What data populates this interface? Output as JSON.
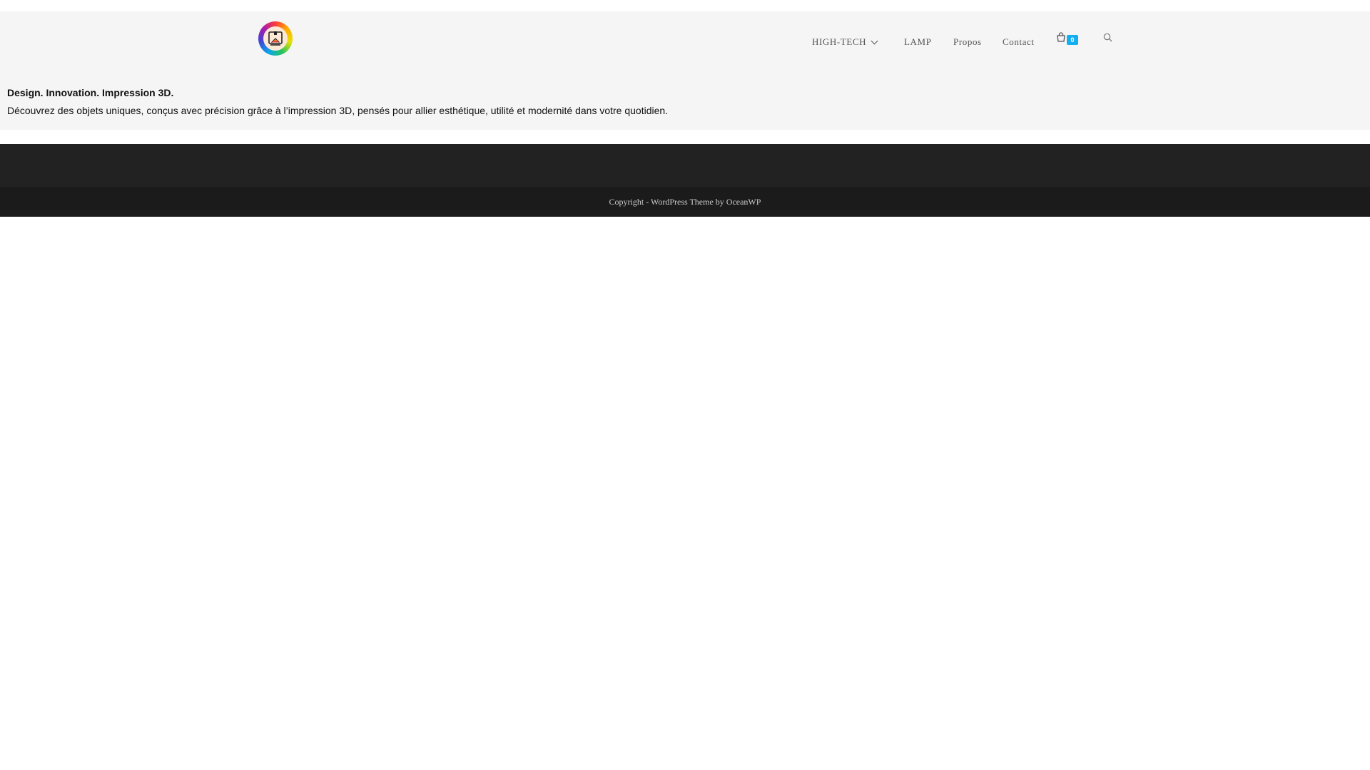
{
  "header": {
    "logo_icon": "3d-printer-logo-icon",
    "nav": {
      "items": [
        {
          "label": "HIGH-TECH",
          "has_dropdown": true
        },
        {
          "label": "LAMP"
        },
        {
          "label": "Propos"
        },
        {
          "label": "Contact"
        }
      ],
      "cart_icon": "shopping-bag-icon",
      "cart_count": "0",
      "search_icon": "search-icon"
    },
    "tagline": "Design. Innovation. Impression 3D.",
    "description": "Découvrez des objets uniques, conçus avec précision grâce à l’impression 3D, pensés pour allier esthétique, utilité et modernité dans votre quotidien."
  },
  "footer": {
    "copyright": "Copyright - WordPress Theme by OceanWP"
  },
  "colors": {
    "header_bg": "#f5f5f6",
    "accent": "#13aff0",
    "footer_bg": "#1b1b1b",
    "widgets_bg": "#222222"
  }
}
